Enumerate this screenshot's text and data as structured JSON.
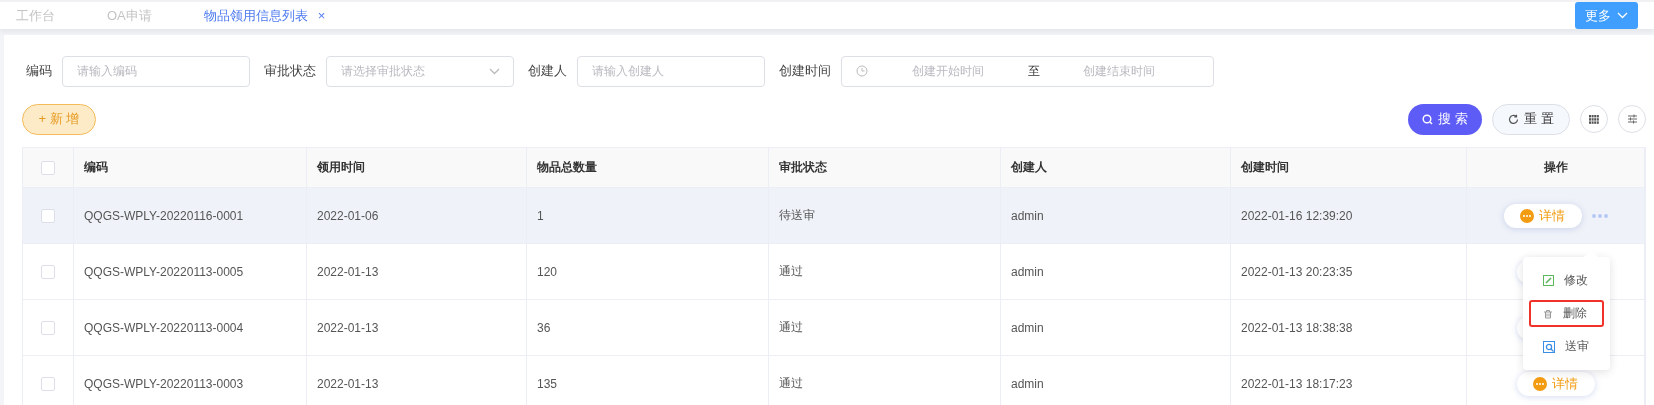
{
  "tabs": [
    {
      "label": "工作台",
      "selected": false
    },
    {
      "label": "OA申请",
      "selected": false
    },
    {
      "label": "物品领用信息列表",
      "selected": true,
      "close": "×"
    }
  ],
  "more_button": "更多",
  "filters": [
    {
      "kind": "input",
      "label": "编码",
      "placeholder": "请输入编码"
    },
    {
      "kind": "select",
      "label": "审批状态",
      "placeholder": "请选择审批状态"
    },
    {
      "kind": "input",
      "label": "创建人",
      "placeholder": "请输入创建人"
    },
    {
      "kind": "daterange",
      "label": "创建时间",
      "placeholder": "创建开始时间",
      "separator": "至",
      "placeholder_end": "创建结束时间"
    }
  ],
  "add_button": "+ 新 增",
  "search_button": "搜 索",
  "reset_button": "重 置",
  "table": {
    "header_checked": false,
    "columns": [
      "编码",
      "领用时间",
      "物品总数量",
      "审批状态",
      "创建人",
      "创建时间",
      "操作"
    ],
    "rows": [
      {
        "hovered": true,
        "checked": false,
        "cells": [
          "QQGS-WPLY-20220116-0001",
          "2022-01-06",
          "1",
          "待送审",
          "admin",
          "2022-01-16 12:39:20"
        ],
        "action": "详情",
        "menu_open": true
      },
      {
        "hovered": false,
        "checked": false,
        "cells": [
          "QQGS-WPLY-20220113-0005",
          "2022-01-13",
          "120",
          "通过",
          "admin",
          "2022-01-13 20:23:35"
        ]
      },
      {
        "hovered": false,
        "checked": false,
        "cells": [
          "QQGS-WPLY-20220113-0004",
          "2022-01-13",
          "36",
          "通过",
          "admin",
          "2022-01-13 18:38:38"
        ]
      },
      {
        "hovered": false,
        "checked": false,
        "cells": [
          "QQGS-WPLY-20220113-0003",
          "2022-01-13",
          "135",
          "通过",
          "admin",
          "2022-01-13 18:17:23"
        ],
        "action": "详情"
      }
    ]
  },
  "action_menu": [
    {
      "kind": "edit",
      "label": "修改",
      "highlighted": false
    },
    {
      "kind": "delete",
      "label": "删除",
      "highlighted": true
    },
    {
      "kind": "submit",
      "label": "送审",
      "highlighted": false
    }
  ]
}
